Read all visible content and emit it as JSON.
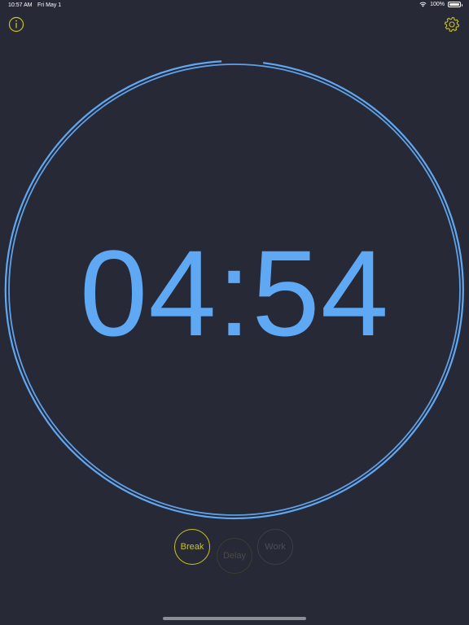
{
  "status_bar": {
    "time": "10:57 AM",
    "date": "Fri May 1",
    "battery": "100%"
  },
  "toolbar": {
    "info_icon": "info-icon",
    "settings_icon": "gear-icon"
  },
  "timer": {
    "display": "04:54",
    "progress": 0.02
  },
  "modes": {
    "break_label": "Break",
    "delay_label": "Delay",
    "work_label": "Work",
    "active": "Break"
  },
  "colors": {
    "background": "#272937",
    "accent_yellow": "#c9c422",
    "timer_blue": "#5fa8f3"
  }
}
